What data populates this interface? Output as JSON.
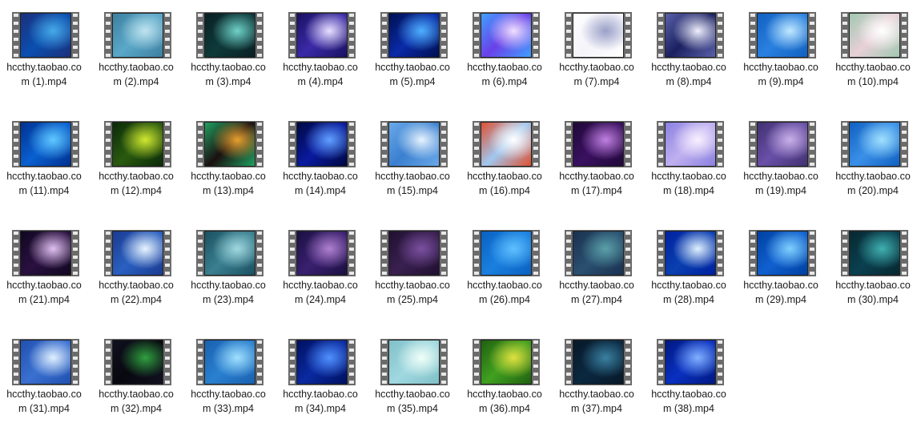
{
  "view": "file-icon-grid",
  "files": [
    {
      "name": "hccthy.taobao.com (1).mp4",
      "icon": "video-file-icon",
      "colors": [
        "#0a4fb0",
        "#48a9e8",
        "#1b2f7a"
      ]
    },
    {
      "name": "hccthy.taobao.com (2).mp4",
      "icon": "video-file-icon",
      "colors": [
        "#5aa8c8",
        "#bfe3ef",
        "#3c7fa0"
      ]
    },
    {
      "name": "hccthy.taobao.com (3).mp4",
      "icon": "video-file-icon",
      "colors": [
        "#0e3a3a",
        "#6fd1c8",
        "#0a1f24"
      ]
    },
    {
      "name": "hccthy.taobao.com (4).mp4",
      "icon": "video-file-icon",
      "colors": [
        "#3a2aa8",
        "#e8e0ff",
        "#1a1060"
      ]
    },
    {
      "name": "hccthy.taobao.com (5).mp4",
      "icon": "video-file-icon",
      "colors": [
        "#0a2aa8",
        "#4fb0ff",
        "#001050"
      ]
    },
    {
      "name": "hccthy.taobao.com (6).mp4",
      "icon": "video-file-icon",
      "colors": [
        "#6a40e8",
        "#f0e0ff",
        "#40a0ff"
      ]
    },
    {
      "name": "hccthy.taobao.com (7).mp4",
      "icon": "video-file-icon",
      "colors": [
        "#f4f4fa",
        "#9aa0c8",
        "#ffffff"
      ]
    },
    {
      "name": "hccthy.taobao.com (8).mp4",
      "icon": "video-file-icon",
      "colors": [
        "#1a2060",
        "#f0f0ff",
        "#5a60a8"
      ]
    },
    {
      "name": "hccthy.taobao.com (9).mp4",
      "icon": "video-file-icon",
      "colors": [
        "#2a80e0",
        "#c0e8ff",
        "#1060c0"
      ]
    },
    {
      "name": "hccthy.taobao.com (10).mp4",
      "icon": "video-file-icon",
      "colors": [
        "#e8d0d8",
        "#ffffff",
        "#a0c8b0"
      ]
    },
    {
      "name": "hccthy.taobao.com (11).mp4",
      "icon": "video-file-icon",
      "colors": [
        "#0a60d0",
        "#60c8ff",
        "#003090"
      ]
    },
    {
      "name": "hccthy.taobao.com (12).mp4",
      "icon": "video-file-icon",
      "colors": [
        "#2a5a10",
        "#d0e830",
        "#0a2a08"
      ]
    },
    {
      "name": "hccthy.taobao.com (13).mp4",
      "icon": "video-file-icon",
      "colors": [
        "#1a1010",
        "#e8a030",
        "#20a060"
      ]
    },
    {
      "name": "hccthy.taobao.com (14).mp4",
      "icon": "video-file-icon",
      "colors": [
        "#0a1aa0",
        "#60a0ff",
        "#000840"
      ]
    },
    {
      "name": "hccthy.taobao.com (15).mp4",
      "icon": "video-file-icon",
      "colors": [
        "#3a80d0",
        "#e8f4ff",
        "#6aa8e8"
      ]
    },
    {
      "name": "hccthy.taobao.com (16).mp4",
      "icon": "video-file-icon",
      "colors": [
        "#a0c8f0",
        "#ffffff",
        "#e05030"
      ]
    },
    {
      "name": "hccthy.taobao.com (17).mp4",
      "icon": "video-file-icon",
      "colors": [
        "#3a1060",
        "#c080e0",
        "#200838"
      ]
    },
    {
      "name": "hccthy.taobao.com (18).mp4",
      "icon": "video-file-icon",
      "colors": [
        "#c0b0f0",
        "#f8f0ff",
        "#8a80e0"
      ]
    },
    {
      "name": "hccthy.taobao.com (19).mp4",
      "icon": "video-file-icon",
      "colors": [
        "#6a50a8",
        "#c8b0e8",
        "#403070"
      ]
    },
    {
      "name": "hccthy.taobao.com (20).mp4",
      "icon": "video-file-icon",
      "colors": [
        "#3a90e8",
        "#a0e0ff",
        "#1060c0"
      ]
    },
    {
      "name": "hccthy.taobao.com (21).mp4",
      "icon": "video-file-icon",
      "colors": [
        "#2a1040",
        "#e0c0f0",
        "#100820"
      ]
    },
    {
      "name": "hccthy.taobao.com (22).mp4",
      "icon": "video-file-icon",
      "colors": [
        "#2a60c0",
        "#e8f4ff",
        "#1a3a90"
      ]
    },
    {
      "name": "hccthy.taobao.com (23).mp4",
      "icon": "video-file-icon",
      "colors": [
        "#3a8090",
        "#a0d8e0",
        "#1a5060"
      ]
    },
    {
      "name": "hccthy.taobao.com (24).mp4",
      "icon": "video-file-icon",
      "colors": [
        "#3a2070",
        "#b080d0",
        "#1a1040"
      ]
    },
    {
      "name": "hccthy.taobao.com (25).mp4",
      "icon": "video-file-icon",
      "colors": [
        "#3a2050",
        "#7a50a0",
        "#201030"
      ]
    },
    {
      "name": "hccthy.taobao.com (26).mp4",
      "icon": "video-file-icon",
      "colors": [
        "#1a80e0",
        "#60c0ff",
        "#0a60c0"
      ]
    },
    {
      "name": "hccthy.taobao.com (27).mp4",
      "icon": "video-file-icon",
      "colors": [
        "#2a5070",
        "#5aa0a8",
        "#1a3050"
      ]
    },
    {
      "name": "hccthy.taobao.com (28).mp4",
      "icon": "video-file-icon",
      "colors": [
        "#0a40b0",
        "#e0f0ff",
        "#0020a0"
      ]
    },
    {
      "name": "hccthy.taobao.com (29).mp4",
      "icon": "video-file-icon",
      "colors": [
        "#1060d0",
        "#80d0ff",
        "#0040a0"
      ]
    },
    {
      "name": "hccthy.taobao.com (30).mp4",
      "icon": "video-file-icon",
      "colors": [
        "#0a4050",
        "#40b0b0",
        "#082830"
      ]
    },
    {
      "name": "hccthy.taobao.com (31).mp4",
      "icon": "video-file-icon",
      "colors": [
        "#3a70d0",
        "#e0f0ff",
        "#2050b0"
      ]
    },
    {
      "name": "hccthy.taobao.com (32).mp4",
      "icon": "video-file-icon",
      "colors": [
        "#080810",
        "#30a040",
        "#101020"
      ]
    },
    {
      "name": "hccthy.taobao.com (33).mp4",
      "icon": "video-file-icon",
      "colors": [
        "#2a80d0",
        "#a0e0ff",
        "#1a60b0"
      ]
    },
    {
      "name": "hccthy.taobao.com (34).mp4",
      "icon": "video-file-icon",
      "colors": [
        "#0a2aa0",
        "#5090ff",
        "#001060"
      ]
    },
    {
      "name": "hccthy.taobao.com (35).mp4",
      "icon": "video-file-icon",
      "colors": [
        "#a0d8e0",
        "#f0fff8",
        "#80c0c8"
      ]
    },
    {
      "name": "hccthy.taobao.com (36).mp4",
      "icon": "video-file-icon",
      "colors": [
        "#40a020",
        "#e0e040",
        "#206010"
      ]
    },
    {
      "name": "hccthy.taobao.com (37).mp4",
      "icon": "video-file-icon",
      "colors": [
        "#0a2840",
        "#3a80a0",
        "#081828"
      ]
    },
    {
      "name": "hccthy.taobao.com (38).mp4",
      "icon": "video-file-icon",
      "colors": [
        "#0a30c0",
        "#80b0ff",
        "#001880"
      ]
    }
  ]
}
